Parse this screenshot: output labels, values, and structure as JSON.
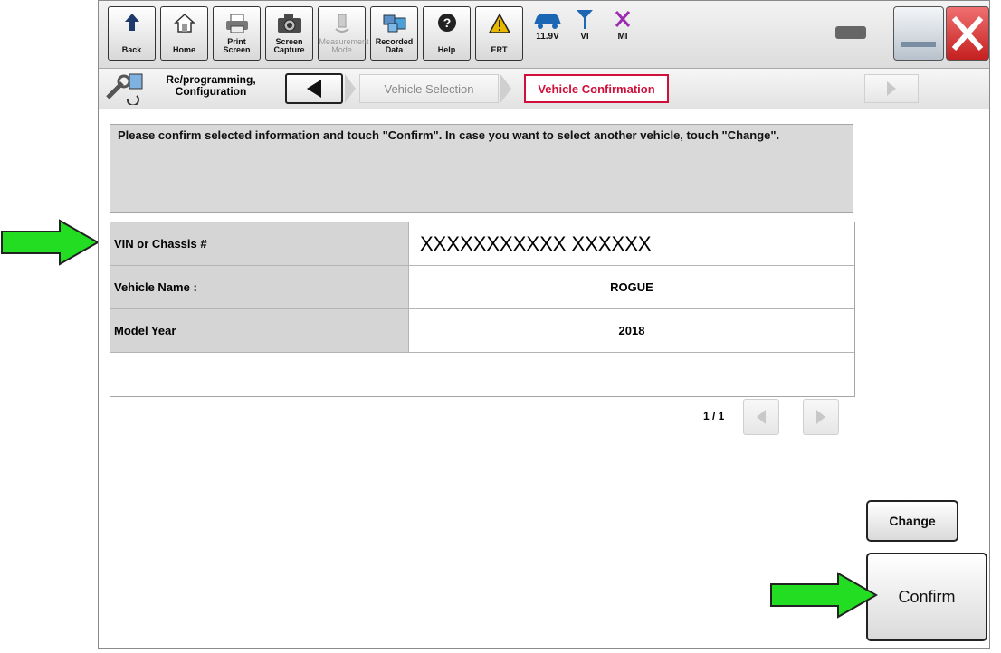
{
  "toolbar": {
    "buttons": [
      {
        "label": "Back",
        "icon": "back-arrow-icon"
      },
      {
        "label": "Home",
        "icon": "home-icon"
      },
      {
        "label": "Print Screen",
        "icon": "printer-icon"
      },
      {
        "label": "Screen Capture",
        "icon": "camera-icon"
      },
      {
        "label": "Measurement Mode",
        "icon": "measurement-icon"
      },
      {
        "label": "Recorded Data",
        "icon": "recorded-data-icon"
      },
      {
        "label": "Help",
        "icon": "help-icon"
      },
      {
        "label": "ERT",
        "icon": "warning-icon"
      }
    ],
    "status": {
      "voltage": "11.9V",
      "vi": "VI",
      "mi": "MI"
    }
  },
  "nav": {
    "section_line1": "Re/programming,",
    "section_line2": "Configuration",
    "step1": "Vehicle Selection",
    "step2": "Vehicle Confirmation"
  },
  "content": {
    "message": "Please confirm selected information and touch \"Confirm\". In case you want to select another vehicle, touch \"Change\".",
    "rows": [
      {
        "label": "VIN or Chassis #",
        "value": "XXXXXXXXXXX XXXXXX"
      },
      {
        "label": "Vehicle Name :",
        "value": "ROGUE"
      },
      {
        "label": "Model Year",
        "value": "2018"
      }
    ],
    "page": "1 / 1",
    "change_label": "Change",
    "confirm_label": "Confirm"
  },
  "colors": {
    "accent": "#d0103a",
    "arrow": "#22dd22",
    "ert": "#e8b800",
    "status_blue": "#1b67b3",
    "mi": "#9b2bb0",
    "close": "#d43030"
  }
}
